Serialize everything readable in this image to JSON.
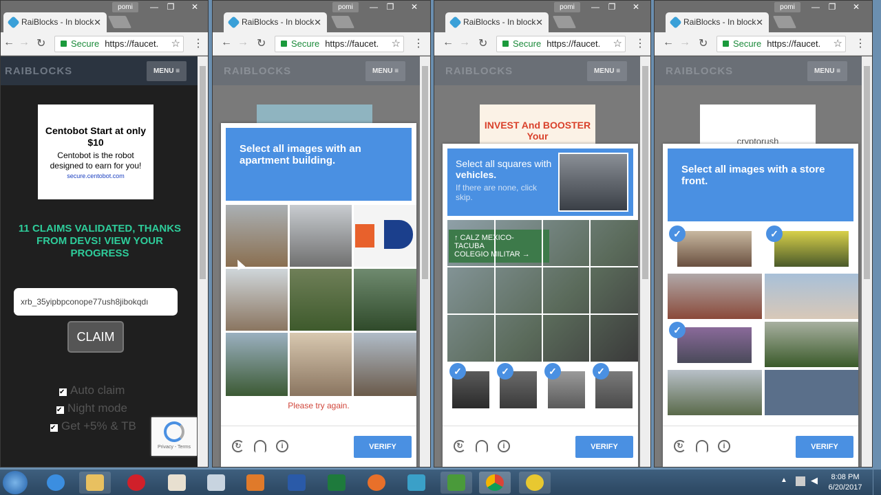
{
  "windows": [
    {
      "tab_title": "RaiBlocks - In block",
      "user": "pomi",
      "url": "https://faucet.",
      "secure": "Secure"
    },
    {
      "tab_title": "RaiBlocks - In block",
      "user": "pomi",
      "url": "https://faucet.",
      "secure": "Secure"
    },
    {
      "tab_title": "RaiBlocks - In block",
      "user": "pomi",
      "url": "https://faucet.",
      "secure": "Secure"
    },
    {
      "tab_title": "RaiBlocks - In block",
      "user": "pomi",
      "url": "https://faucet.",
      "secure": "Secure"
    }
  ],
  "site": {
    "logo": "RAIBLOCKS",
    "menu": "MENU ≡"
  },
  "page1": {
    "ad_title": "Centobot Start at only $10",
    "ad_body": "Centobot is the robot designed to earn for you!",
    "ad_link": "secure.centobot.com",
    "claims_text": "11 CLAIMS VALIDATED, THANKS FROM DEVS! VIEW YOUR PROGRESS",
    "address_value": "xrb_35yipbpconope77ush8jibokqdı",
    "claim_button": "CLAIM",
    "options": [
      {
        "label": "Auto claim",
        "checked": true
      },
      {
        "label": "Night mode",
        "checked": true
      },
      {
        "label": "Get +5% & TB",
        "checked": true
      }
    ],
    "recaptcha_links": "Privacy - Terms"
  },
  "captcha2": {
    "prompt_pre": "Select all images with an",
    "prompt_bold": "apartment building.",
    "error": "Please try again.",
    "verify": "VERIFY"
  },
  "captcha3": {
    "ad_text": "INVEST And BOOSTER Your",
    "prompt_pre": "Select all squares with",
    "prompt_bold": "vehicles.",
    "sub": "If there are none, click skip.",
    "verify": "VERIFY"
  },
  "captcha4": {
    "ad_text": "cryptorush",
    "prompt_pre": "Select all images with a",
    "prompt_bold": "store front.",
    "verify": "VERIFY"
  },
  "taskbar": {
    "time": "8:08 PM",
    "date": "6/20/2017"
  },
  "colors": {
    "accent": "#4a90e2",
    "claims": "#2ecc9a",
    "error": "#d0453a"
  }
}
